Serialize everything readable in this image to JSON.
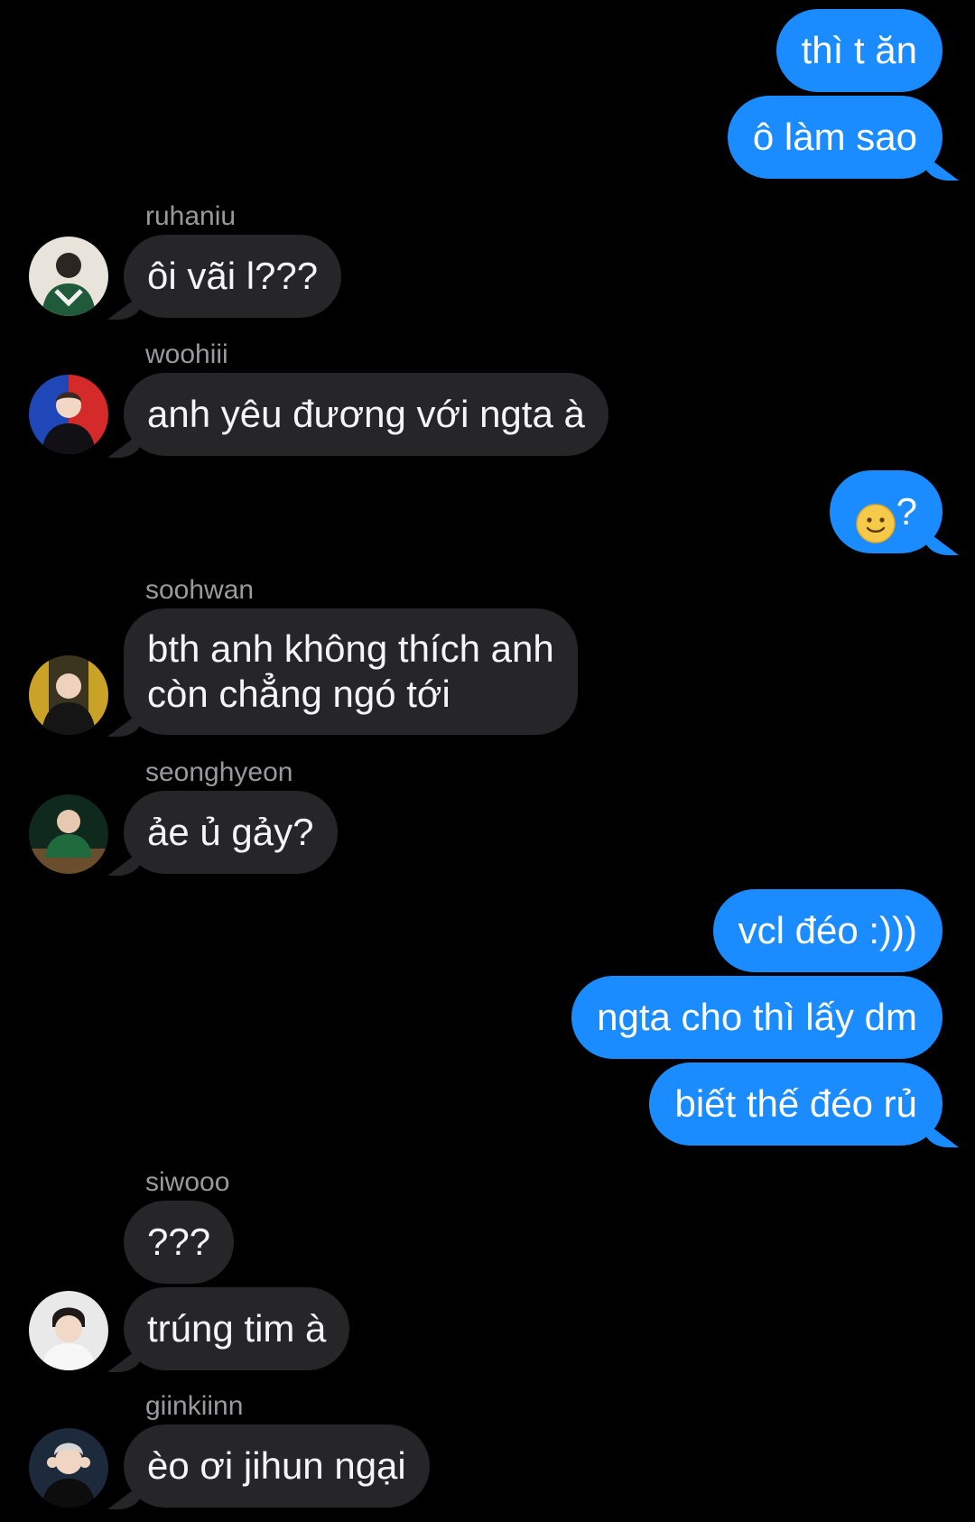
{
  "messages": {
    "out_1": "thì t ăn",
    "out_2": "ô làm sao",
    "in_1": {
      "sender": "ruhaniu",
      "text": "ôi vãi l???"
    },
    "in_2": {
      "sender": "woohiii",
      "text": "anh yêu đương với ngta à"
    },
    "out_3": "🙂?",
    "in_3": {
      "sender": "soohwan",
      "line1": "bth anh không thích anh",
      "line2": "còn chẳng ngó tới"
    },
    "in_4": {
      "sender": "seonghyeon",
      "text": "ảe ủ gảy?"
    },
    "out_4": "vcl đéo :)))",
    "out_5": "ngta cho thì lấy dm",
    "out_6": "biết thế đéo rủ",
    "in_5": {
      "sender": "siwooo",
      "text_a": "???",
      "text_b": "trúng tim à"
    },
    "in_6": {
      "sender": "giinkiinn",
      "text": "èo ơi jihun ngại"
    }
  },
  "colors": {
    "background": "#000000",
    "outgoing_bubble": "#1a8cff",
    "incoming_bubble": "#262629",
    "sender_name": "#9a9a9e"
  }
}
